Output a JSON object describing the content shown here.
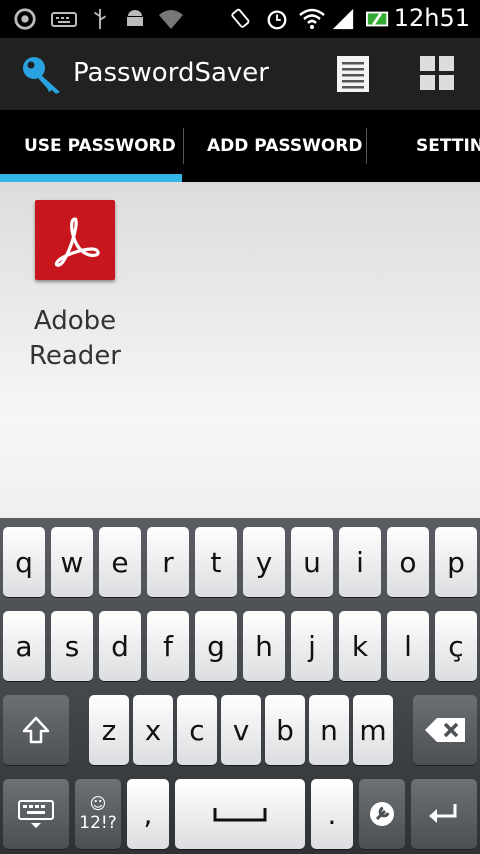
{
  "status_bar": {
    "time": "12h51",
    "icons": [
      "sync-icon",
      "keyboard-icon",
      "usb-icon",
      "android-icon",
      "wifi-question-icon",
      "rotate-icon",
      "alarm-icon",
      "wifi-icon",
      "signal-icon",
      "battery-charging-icon"
    ]
  },
  "action_bar": {
    "title": "PasswordSaver",
    "icons": [
      "key-icon",
      "list-icon",
      "grid-icon"
    ]
  },
  "tabs": [
    {
      "label": "USE PASSWORD",
      "selected": true
    },
    {
      "label": "ADD PASSWORD",
      "selected": false
    },
    {
      "label": "SETTINGS",
      "selected": false
    }
  ],
  "apps": [
    {
      "label": "Adobe Reader",
      "line1": "Adobe",
      "line2": "Reader",
      "icon": "adobe-reader-icon"
    }
  ],
  "keyboard": {
    "row1": [
      "q",
      "w",
      "e",
      "r",
      "t",
      "y",
      "u",
      "i",
      "o",
      "p"
    ],
    "row2": [
      "a",
      "s",
      "d",
      "f",
      "g",
      "h",
      "j",
      "k",
      "l",
      "ç"
    ],
    "row3": [
      "z",
      "x",
      "c",
      "v",
      "b",
      "n",
      "m"
    ],
    "symbols_label": "12!?",
    "comma": ",",
    "period": "."
  },
  "colors": {
    "tab_indicator": "#33b5e5",
    "action_bar": "#212121",
    "adobe_red": "#c8161e"
  }
}
